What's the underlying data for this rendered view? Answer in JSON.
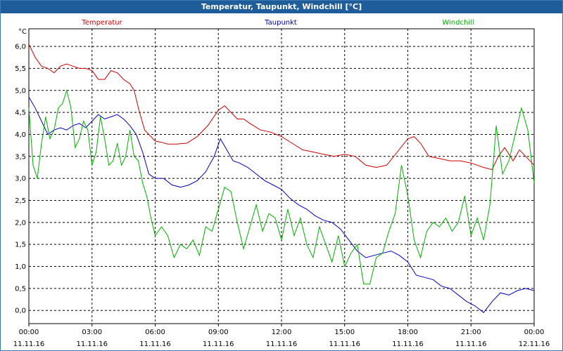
{
  "window": {
    "title": "Temperatur, Taupunkt, Windchill [°C]"
  },
  "colors": {
    "temperature": "#d00000",
    "dewpoint": "#0000c0",
    "windchill": "#00b000",
    "titlebar": "#1f5c9a"
  },
  "chart_data": {
    "type": "line",
    "unit_label": "°C",
    "ylim": [
      -0.3,
      6.4
    ],
    "yticks": [
      0.0,
      0.5,
      1.0,
      1.5,
      2.0,
      2.5,
      3.0,
      3.5,
      4.0,
      4.5,
      5.0,
      5.5,
      6.0
    ],
    "ytick_labels": [
      "0,0",
      "0,5",
      "1,0",
      "1,5",
      "2,0",
      "2,5",
      "3,0",
      "3,5",
      "4,0",
      "4,5",
      "5,0",
      "5,5",
      "6,0"
    ],
    "xlim": [
      0,
      24
    ],
    "xticks": [
      {
        "time": "00:00",
        "date": "11.11.16"
      },
      {
        "time": "03:00",
        "date": "11.11.16"
      },
      {
        "time": "06:00",
        "date": "11.11.16"
      },
      {
        "time": "09:00",
        "date": "11.11.16"
      },
      {
        "time": "12:00",
        "date": "11.11.16"
      },
      {
        "time": "15:00",
        "date": "11.11.16"
      },
      {
        "time": "18:00",
        "date": "11.11.16"
      },
      {
        "time": "21:00",
        "date": "11.11.16"
      },
      {
        "time": "00:00",
        "date": "12.11.16"
      }
    ],
    "grid": true,
    "legend_position": "top",
    "series": [
      {
        "name": "Temperatur",
        "color": "#d00000",
        "x": [
          0,
          0.3,
          0.6,
          0.9,
          1.2,
          1.5,
          1.8,
          2.1,
          2.4,
          2.7,
          3.0,
          3.3,
          3.6,
          3.9,
          4.2,
          4.5,
          4.8,
          5.0,
          5.2,
          5.5,
          5.8,
          6.0,
          6.3,
          6.6,
          7.0,
          7.5,
          8.0,
          8.5,
          9.0,
          9.3,
          9.6,
          9.9,
          10.2,
          10.5,
          11.0,
          11.5,
          12.0,
          12.5,
          13.0,
          13.5,
          14.0,
          14.5,
          15.0,
          15.5,
          16.0,
          16.5,
          17.0,
          17.5,
          18.0,
          18.3,
          18.6,
          19.0,
          19.5,
          20.0,
          20.5,
          21.0,
          21.3,
          21.6,
          22.0,
          22.3,
          22.6,
          23.0,
          23.3,
          23.6,
          24.0
        ],
        "y": [
          6.05,
          5.75,
          5.55,
          5.5,
          5.4,
          5.55,
          5.6,
          5.55,
          5.5,
          5.5,
          5.45,
          5.25,
          5.25,
          5.45,
          5.4,
          5.25,
          5.15,
          5.0,
          4.6,
          4.1,
          3.95,
          3.85,
          3.82,
          3.78,
          3.78,
          3.8,
          3.95,
          4.2,
          4.55,
          4.65,
          4.5,
          4.35,
          4.35,
          4.25,
          4.1,
          4.05,
          3.95,
          3.8,
          3.65,
          3.6,
          3.55,
          3.5,
          3.55,
          3.5,
          3.3,
          3.25,
          3.3,
          3.6,
          3.9,
          3.95,
          3.8,
          3.5,
          3.45,
          3.4,
          3.4,
          3.35,
          3.3,
          3.25,
          3.2,
          3.5,
          3.7,
          3.4,
          3.65,
          3.5,
          3.3
        ]
      },
      {
        "name": "Taupunkt",
        "color": "#0000c0",
        "x": [
          0,
          0.3,
          0.6,
          0.9,
          1.2,
          1.5,
          1.8,
          2.1,
          2.4,
          2.7,
          3.0,
          3.3,
          3.6,
          3.9,
          4.2,
          4.5,
          4.8,
          5.1,
          5.4,
          5.7,
          6.0,
          6.4,
          6.8,
          7.2,
          7.6,
          8.0,
          8.4,
          8.8,
          9.1,
          9.4,
          9.7,
          10.0,
          10.4,
          10.8,
          11.2,
          11.6,
          12.0,
          12.4,
          12.8,
          13.2,
          13.6,
          14.0,
          14.4,
          14.8,
          15.2,
          15.6,
          16.0,
          16.4,
          16.8,
          17.2,
          17.6,
          18.0,
          18.4,
          18.8,
          19.2,
          19.6,
          20.0,
          20.4,
          20.8,
          21.2,
          21.6,
          22.0,
          22.4,
          22.8,
          23.2,
          23.6,
          24.0
        ],
        "y": [
          4.85,
          4.6,
          4.3,
          4.0,
          4.1,
          4.15,
          4.1,
          4.2,
          4.25,
          4.15,
          4.3,
          4.45,
          4.35,
          4.4,
          4.45,
          4.35,
          4.2,
          4.0,
          3.6,
          3.1,
          3.0,
          3.0,
          2.85,
          2.8,
          2.85,
          2.95,
          3.15,
          3.5,
          3.9,
          3.65,
          3.4,
          3.35,
          3.25,
          3.1,
          2.95,
          2.85,
          2.75,
          2.55,
          2.4,
          2.3,
          2.15,
          2.05,
          2.0,
          1.85,
          1.6,
          1.35,
          1.2,
          1.25,
          1.3,
          1.35,
          1.25,
          1.1,
          0.8,
          0.75,
          0.7,
          0.55,
          0.5,
          0.35,
          0.2,
          0.1,
          -0.05,
          0.2,
          0.4,
          0.35,
          0.45,
          0.5,
          0.45
        ]
      },
      {
        "name": "Windchill",
        "color": "#00b000",
        "x": [
          0,
          0.2,
          0.4,
          0.6,
          0.8,
          1.0,
          1.2,
          1.4,
          1.6,
          1.8,
          2.0,
          2.2,
          2.4,
          2.6,
          2.8,
          3.0,
          3.2,
          3.4,
          3.6,
          3.8,
          4.0,
          4.2,
          4.4,
          4.6,
          4.8,
          5.0,
          5.2,
          5.4,
          5.6,
          5.8,
          6.0,
          6.3,
          6.6,
          6.9,
          7.2,
          7.5,
          7.8,
          8.1,
          8.4,
          8.7,
          9.0,
          9.3,
          9.6,
          9.9,
          10.2,
          10.5,
          10.8,
          11.1,
          11.4,
          11.7,
          12.0,
          12.3,
          12.6,
          12.9,
          13.2,
          13.5,
          13.8,
          14.1,
          14.4,
          14.7,
          15.0,
          15.3,
          15.6,
          15.9,
          16.2,
          16.5,
          16.8,
          17.1,
          17.4,
          17.7,
          18.0,
          18.3,
          18.6,
          18.9,
          19.2,
          19.5,
          19.8,
          20.1,
          20.4,
          20.7,
          21.0,
          21.3,
          21.6,
          21.9,
          22.2,
          22.5,
          22.8,
          23.1,
          23.4,
          23.7,
          24.0
        ],
        "y": [
          4.6,
          3.3,
          3.0,
          3.8,
          4.4,
          3.9,
          4.1,
          4.6,
          4.7,
          5.0,
          4.6,
          3.7,
          3.9,
          4.3,
          4.1,
          3.3,
          3.6,
          4.4,
          3.9,
          3.3,
          3.4,
          3.8,
          3.3,
          3.5,
          4.1,
          3.5,
          3.4,
          2.9,
          2.6,
          2.1,
          1.7,
          1.9,
          1.7,
          1.2,
          1.5,
          1.4,
          1.6,
          1.25,
          1.9,
          1.8,
          2.3,
          2.8,
          2.7,
          2.0,
          1.4,
          1.9,
          2.4,
          1.8,
          2.2,
          2.1,
          1.6,
          2.3,
          1.7,
          2.1,
          1.5,
          1.2,
          1.9,
          1.5,
          1.1,
          1.7,
          1.0,
          1.3,
          1.5,
          0.6,
          0.6,
          1.2,
          1.3,
          1.8,
          2.2,
          3.3,
          2.6,
          1.6,
          1.2,
          1.8,
          2.0,
          1.9,
          2.1,
          1.8,
          2.0,
          2.6,
          1.7,
          2.1,
          1.6,
          2.4,
          4.2,
          3.1,
          3.4,
          4.0,
          4.6,
          4.1,
          2.9
        ]
      }
    ]
  }
}
